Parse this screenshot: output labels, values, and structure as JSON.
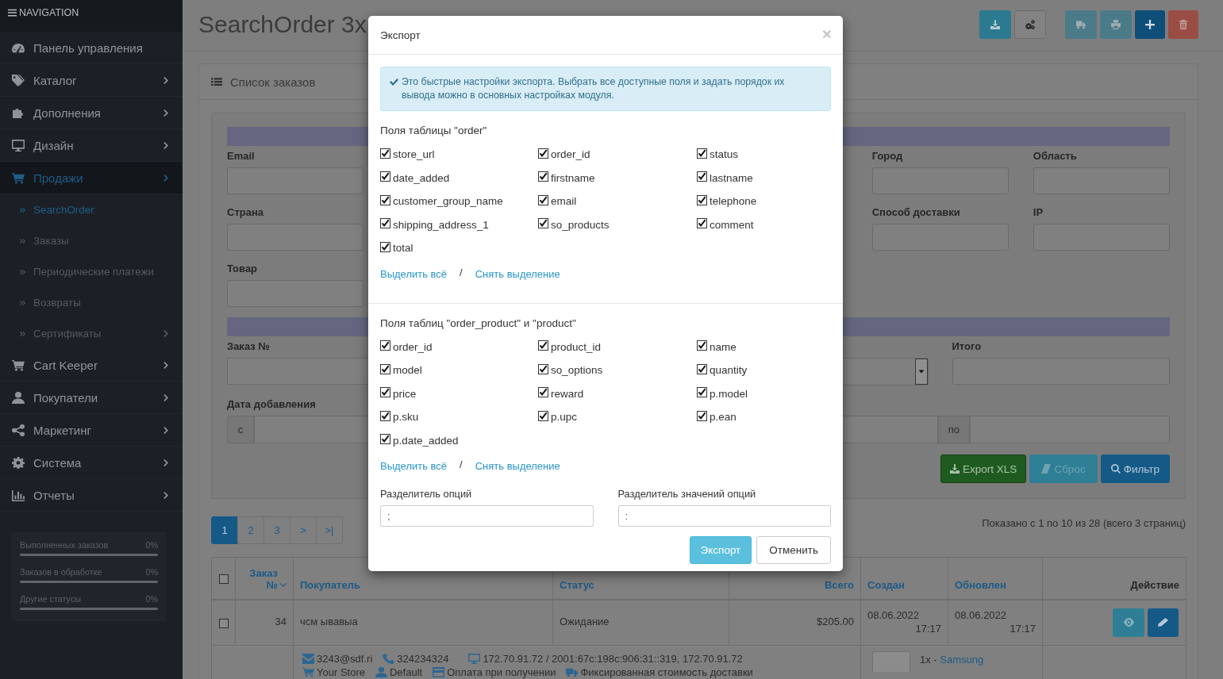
{
  "sidebar": {
    "title": "NAVIGATION",
    "items": [
      {
        "label": "Панель управления",
        "selected": false,
        "has_submenu": false
      },
      {
        "label": "Каталог",
        "selected": false,
        "has_submenu": true
      },
      {
        "label": "Дополнения",
        "selected": false,
        "has_submenu": true
      },
      {
        "label": "Дизайн",
        "selected": false,
        "has_submenu": true
      },
      {
        "label": "Продажи",
        "selected": true,
        "has_submenu": true,
        "children": [
          {
            "label": "SearchOrder",
            "selected": true,
            "has_submenu": false
          },
          {
            "label": "Заказы",
            "selected": false,
            "has_submenu": false
          },
          {
            "label": "Периодические платежи",
            "selected": false,
            "has_submenu": false
          },
          {
            "label": "Возвраты",
            "selected": false,
            "has_submenu": false
          },
          {
            "label": "Сертификаты",
            "selected": false,
            "has_submenu": true
          }
        ]
      },
      {
        "label": "Cart Keeper",
        "selected": false,
        "has_submenu": true
      },
      {
        "label": "Покупатели",
        "selected": false,
        "has_submenu": true
      },
      {
        "label": "Маркетинг",
        "selected": false,
        "has_submenu": true
      },
      {
        "label": "Система",
        "selected": false,
        "has_submenu": true
      },
      {
        "label": "Отчеты",
        "selected": false,
        "has_submenu": true
      }
    ],
    "stats": [
      {
        "label": "Выполненных заказов",
        "value": "0%"
      },
      {
        "label": "Заказов в обработке",
        "value": "0%"
      },
      {
        "label": "Другие статусы",
        "value": "0%"
      }
    ]
  },
  "header": {
    "title": "SearchOrder 3x",
    "toolbar": [
      {
        "kind": "export",
        "disabled": false
      },
      {
        "kind": "settings",
        "disabled": false
      },
      {
        "kind": "shipping",
        "disabled": true
      },
      {
        "kind": "print",
        "disabled": true
      },
      {
        "kind": "add",
        "disabled": false
      },
      {
        "kind": "delete",
        "disabled": false
      }
    ]
  },
  "panel": {
    "title": "Список заказов",
    "filter": {
      "fields": [
        {
          "label": "Email"
        },
        {
          "label": "Город"
        },
        {
          "label": "Область"
        },
        {
          "label": "Страна"
        },
        {
          "label": "Способ доставки"
        },
        {
          "label": "IP"
        },
        {
          "label": "Товар"
        }
      ],
      "fields_2": [
        {
          "kind": "input",
          "label": "Заказ №"
        },
        {
          "kind": "select"
        },
        {
          "kind": "input",
          "label": "Итого"
        }
      ],
      "date_range": {
        "label": "Дата добавления",
        "from": "с",
        "to": "по"
      },
      "buttons": [
        {
          "kind": "export",
          "label": "Export XLS"
        },
        {
          "kind": "reset",
          "label": "Сброс"
        },
        {
          "kind": "filter",
          "label": "Фильтр"
        }
      ]
    },
    "pagination": {
      "pages": [
        {
          "label": "1",
          "selected": true
        },
        {
          "label": "2",
          "selected": false
        },
        {
          "label": "3",
          "selected": false
        },
        {
          "label": ">",
          "selected": false
        },
        {
          "label": ">|",
          "selected": false
        }
      ],
      "summary": "Показано с 1 по 10 из 28 (всего 3 страниц)"
    },
    "table": {
      "select_all": {
        "checked": false
      },
      "columns": [
        {
          "label": "Заказ №",
          "sortable": true,
          "sorted": true
        },
        {
          "label": "Покупатель",
          "sortable": true,
          "sorted": false
        },
        {
          "label": "Статус",
          "sortable": true,
          "sorted": false
        },
        {
          "label": "Всего",
          "sortable": true,
          "sorted": false
        },
        {
          "label": "Создан",
          "sortable": true,
          "sorted": false
        },
        {
          "label": "Обновлен",
          "sortable": true,
          "sorted": false
        },
        {
          "label": "Действие",
          "sortable": false,
          "sorted": false
        }
      ],
      "rows": [
        {
          "checked": false,
          "order_id": "34",
          "customer": "чсм ывавыа",
          "status": "Ожидание",
          "total": "$205.00",
          "created": {
            "date": "08.06.2022",
            "time": "17:17"
          },
          "updated": {
            "date": "08.06.2022",
            "time": "17:17"
          },
          "details": {
            "email": "3243@sdf.ri",
            "phone": "324234324",
            "ip": "172.70.91.72 / 2001:67c:198c:906:31::319, 172.70.91.72",
            "store": "Your Store",
            "customer_group": "Default",
            "payment": "Оплата при получении",
            "shipping": "Фиксированная стоимость доставки",
            "products": [
              {
                "quantity": "1x -",
                "name": "Samsung"
              }
            ]
          }
        }
      ]
    }
  },
  "modal": {
    "title": "Экспорт",
    "close": "×",
    "info": "Это быстрые настройки экспорта. Выбрать все доступные поля и задать порядок их вывода можно в основных настройках модуля.",
    "groups": [
      {
        "title": "Поля таблицы \"order\"",
        "fields": [
          {
            "label": "store_url",
            "checked": true
          },
          {
            "label": "order_id",
            "checked": true
          },
          {
            "label": "status",
            "checked": true
          },
          {
            "label": "date_added",
            "checked": true
          },
          {
            "label": "firstname",
            "checked": true
          },
          {
            "label": "lastname",
            "checked": true
          },
          {
            "label": "customer_group_name",
            "checked": true
          },
          {
            "label": "email",
            "checked": true
          },
          {
            "label": "telephone",
            "checked": true
          },
          {
            "label": "shipping_address_1",
            "checked": true
          },
          {
            "label": "so_products",
            "checked": true
          },
          {
            "label": "comment",
            "checked": true
          },
          {
            "label": "total",
            "checked": true
          }
        ],
        "select_all": "Выделить всё",
        "divider": "/",
        "deselect_all": "Снять выделение"
      },
      {
        "title": "Поля таблиц \"order_product\" и \"product\"",
        "fields": [
          {
            "label": "order_id",
            "checked": true
          },
          {
            "label": "product_id",
            "checked": true
          },
          {
            "label": "name",
            "checked": true
          },
          {
            "label": "model",
            "checked": true
          },
          {
            "label": "so_options",
            "checked": true
          },
          {
            "label": "quantity",
            "checked": true
          },
          {
            "label": "price",
            "checked": true
          },
          {
            "label": "reward",
            "checked": true
          },
          {
            "label": "p.model",
            "checked": true
          },
          {
            "label": "p.sku",
            "checked": true
          },
          {
            "label": "p.upc",
            "checked": true
          },
          {
            "label": "p.ean",
            "checked": true
          },
          {
            "label": "p.date_added",
            "checked": true
          }
        ],
        "select_all": "Выделить всё",
        "divider": "/",
        "deselect_all": "Снять выделение"
      }
    ],
    "separators": [
      {
        "label": "Разделитель опций",
        "value": ";"
      },
      {
        "label": "Разделитель значений опций",
        "value": ":"
      }
    ],
    "buttons": [
      {
        "kind": "export",
        "label": "Экспорт"
      },
      {
        "kind": "cancel",
        "label": "Отменить"
      }
    ]
  }
}
